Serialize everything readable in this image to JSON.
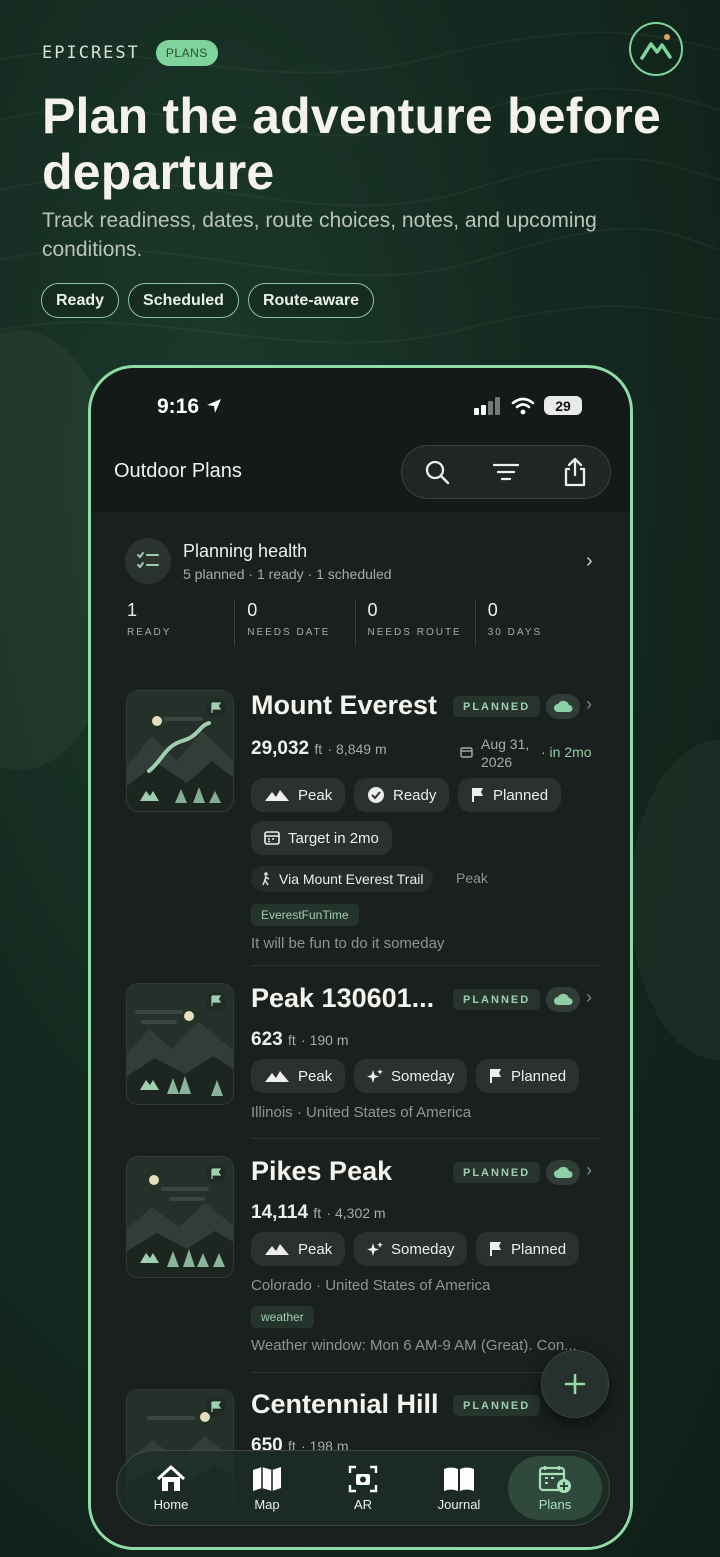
{
  "brand": {
    "name": "EPICREST",
    "badge": "PLANS"
  },
  "hero": {
    "headline": "Plan the adventure before departure",
    "subhead": "Track readiness, dates, route choices, notes, and upcoming conditions.",
    "chips": [
      "Ready",
      "Scheduled",
      "Route-aware"
    ]
  },
  "status_bar": {
    "time": "9:16",
    "battery": "29"
  },
  "nav": {
    "title": "Outdoor Plans"
  },
  "health": {
    "title": "Planning health",
    "subtitle": "5 planned · 1 ready · 1 scheduled",
    "stats": [
      {
        "value": "1",
        "label": "READY"
      },
      {
        "value": "0",
        "label": "NEEDS DATE"
      },
      {
        "value": "0",
        "label": "NEEDS ROUTE"
      },
      {
        "value": "0",
        "label": "30 DAYS"
      }
    ]
  },
  "plans": [
    {
      "title": "Mount Everest",
      "badge": "PLANNED",
      "elevation_ft": "29,032",
      "unit_ft": "ft",
      "elevation_m": "8,849 m",
      "date": "Aug 31, 2026",
      "date_relative": "· in 2mo",
      "pills": [
        "Peak",
        "Ready",
        "Planned",
        "Target in 2mo"
      ],
      "route": "Via Mount Everest Trail",
      "route_type": "Peak",
      "tag": "EverestFunTime",
      "note": "It will be fun to do it someday"
    },
    {
      "title": "Peak 130601...",
      "badge": "PLANNED",
      "elevation_ft": "623",
      "unit_ft": "ft",
      "elevation_m": "190 m",
      "pills": [
        "Peak",
        "Someday",
        "Planned"
      ],
      "location": "Illinois · United States of America"
    },
    {
      "title": "Pikes Peak",
      "badge": "PLANNED",
      "elevation_ft": "14,114",
      "unit_ft": "ft",
      "elevation_m": "4,302 m",
      "pills": [
        "Peak",
        "Someday",
        "Planned"
      ],
      "location": "Colorado · United States of America",
      "tag": "weather",
      "note": "Weather window: Mon 6 AM-9 AM (Great). Con..."
    },
    {
      "title": "Centennial Hill",
      "badge": "PLANNED",
      "elevation_ft": "650",
      "unit_ft": "ft",
      "elevation_m": "198 m"
    }
  ],
  "tabs": [
    {
      "label": "Home",
      "icon": "home-icon"
    },
    {
      "label": "Map",
      "icon": "map-icon"
    },
    {
      "label": "AR",
      "icon": "camera-icon"
    },
    {
      "label": "Journal",
      "icon": "book-icon"
    },
    {
      "label": "Plans",
      "icon": "calendar-plus-icon",
      "active": true
    }
  ],
  "colors": {
    "accent": "#7fd49b",
    "background": "#142a20",
    "card": "#19201d"
  }
}
